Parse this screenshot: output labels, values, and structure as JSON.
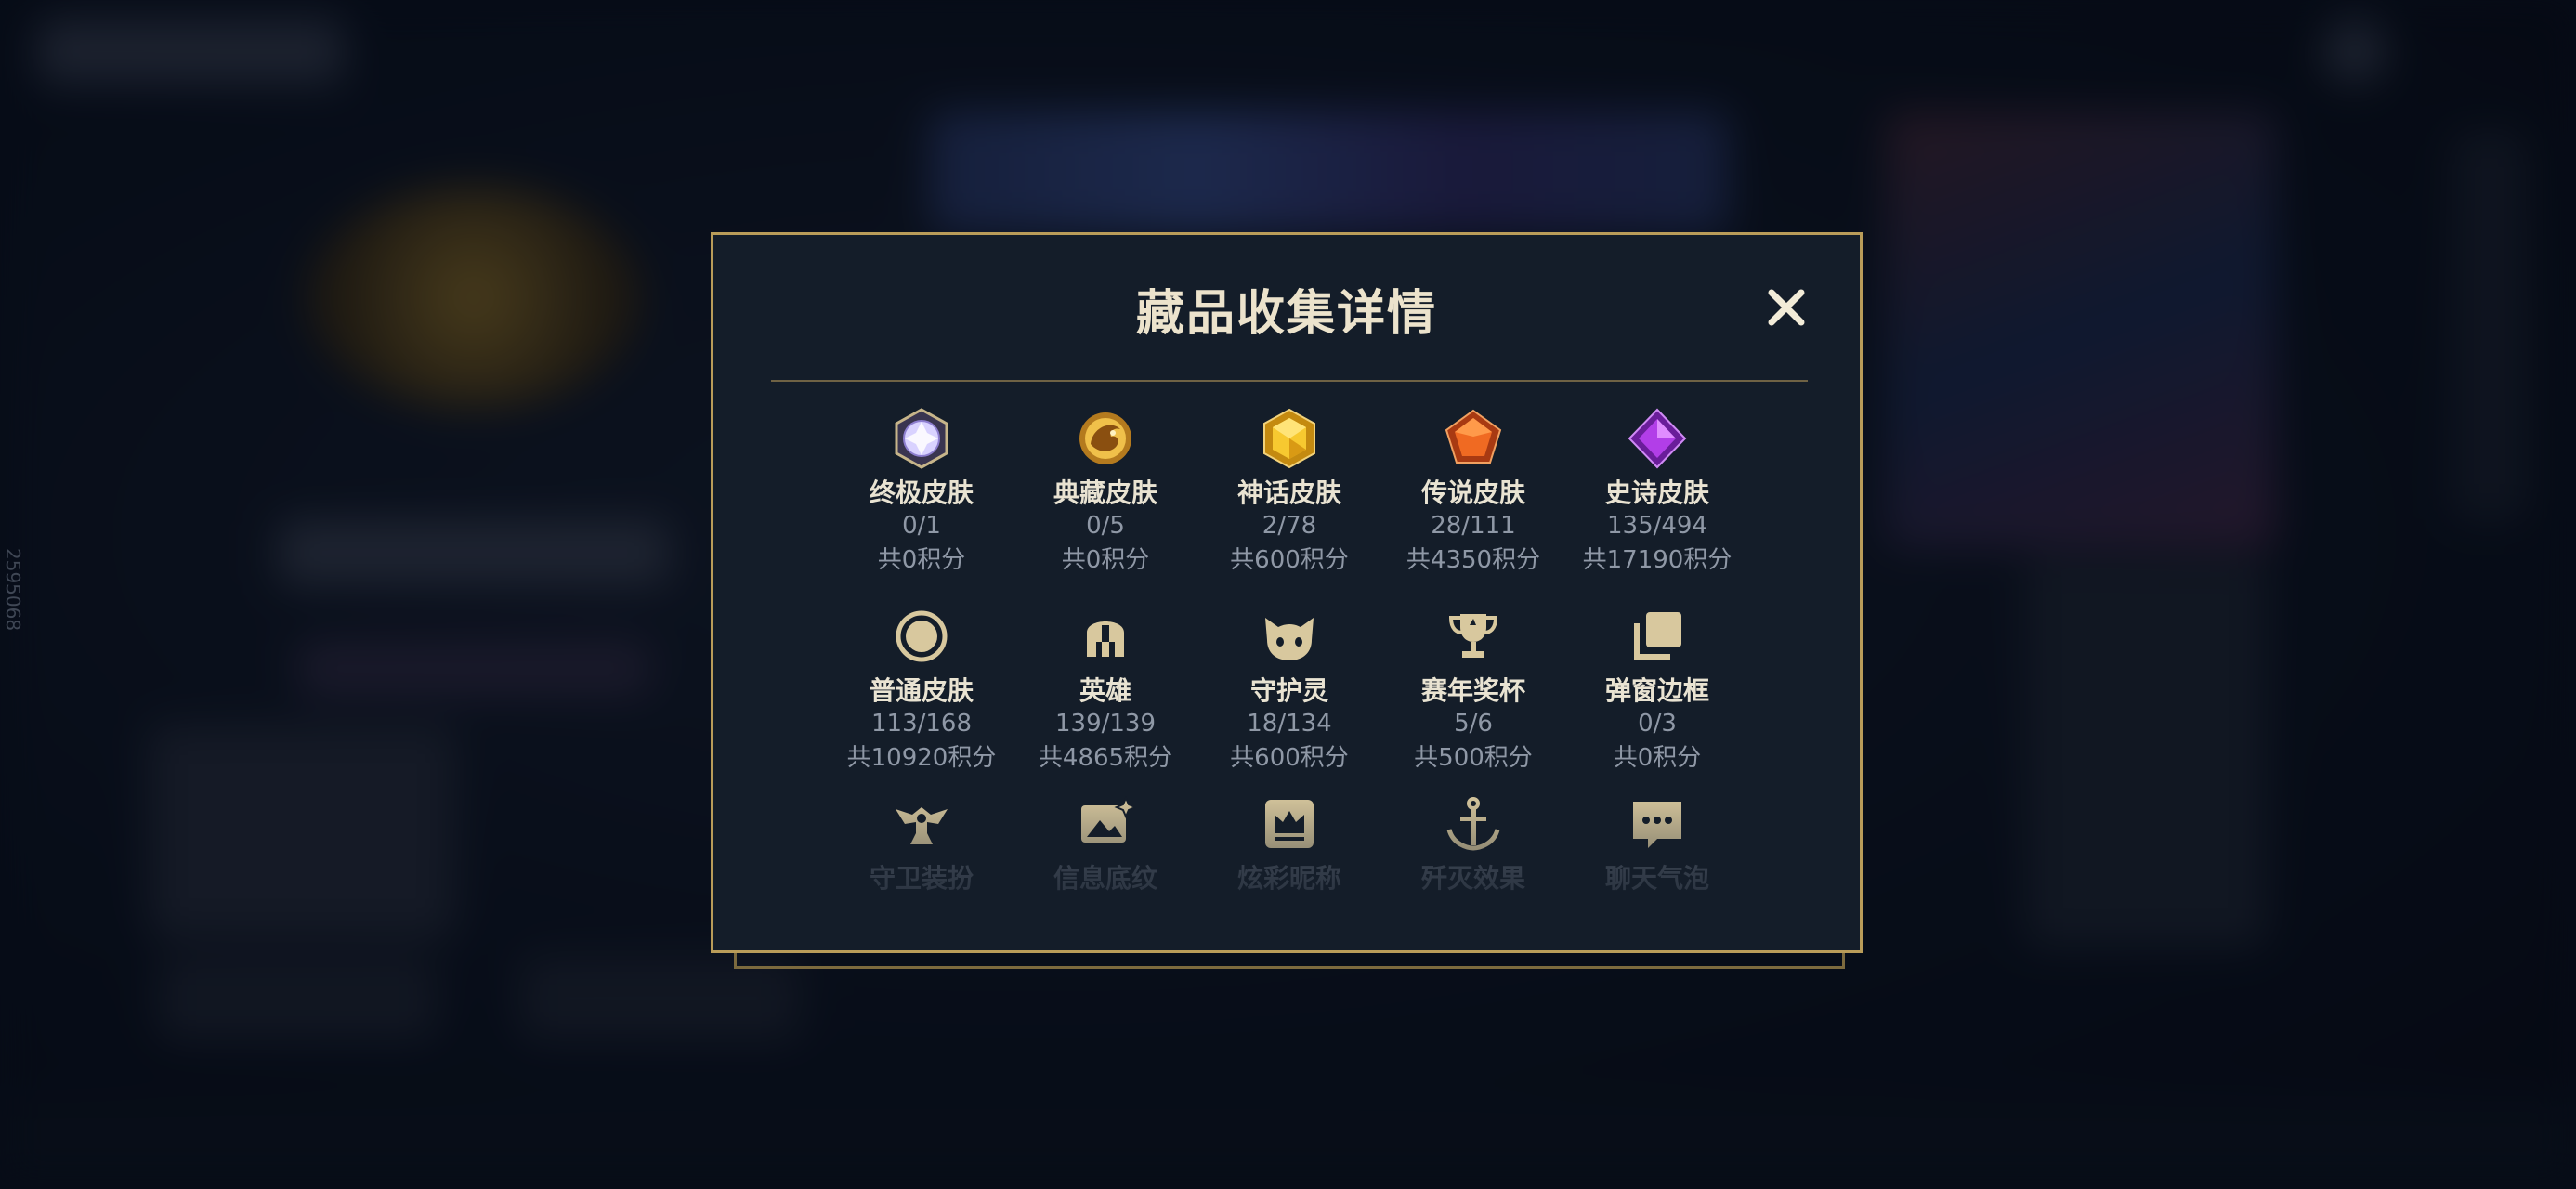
{
  "modal": {
    "title": "藏品收集详情",
    "close_icon": "close-icon"
  },
  "background": {
    "side_id": "2595068"
  },
  "colors": {
    "gold_border": "#b99c59",
    "panel": "#141d29",
    "title_text": "#ece3cc",
    "muted_text": "#8f98a6",
    "icon_tan": "#d8c89e"
  },
  "categories": [
    {
      "label": "终极皮肤",
      "count": "0/1",
      "points": "共0积分",
      "icon": "ultimate-skin-gem-icon"
    },
    {
      "label": "典藏皮肤",
      "count": "0/5",
      "points": "共0积分",
      "icon": "collector-dragon-icon"
    },
    {
      "label": "神话皮肤",
      "count": "2/78",
      "points": "共600积分",
      "icon": "mythic-gem-icon"
    },
    {
      "label": "传说皮肤",
      "count": "28/111",
      "points": "共4350积分",
      "icon": "legendary-gem-icon"
    },
    {
      "label": "史诗皮肤",
      "count": "135/494",
      "points": "共17190积分",
      "icon": "epic-gem-icon"
    },
    {
      "label": "普通皮肤",
      "count": "113/168",
      "points": "共10920积分",
      "icon": "normal-skin-circle-icon"
    },
    {
      "label": "英雄",
      "count": "139/139",
      "points": "共4865积分",
      "icon": "helmet-icon"
    },
    {
      "label": "守护灵",
      "count": "18/134",
      "points": "共600积分",
      "icon": "cat-face-icon"
    },
    {
      "label": "赛年奖杯",
      "count": "5/6",
      "points": "共500积分",
      "icon": "trophy-icon"
    },
    {
      "label": "弹窗边框",
      "count": "0/3",
      "points": "共0积分",
      "icon": "stacked-frames-icon"
    },
    {
      "label": "守卫装扮",
      "icon": "ward-icon"
    },
    {
      "label": "信息底纹",
      "icon": "image-sparkle-icon"
    },
    {
      "label": "炫彩昵称",
      "icon": "crown-card-icon"
    },
    {
      "label": "歼灭效果",
      "icon": "anchor-icon"
    },
    {
      "label": "聊天气泡",
      "icon": "chat-bubble-icon"
    }
  ]
}
